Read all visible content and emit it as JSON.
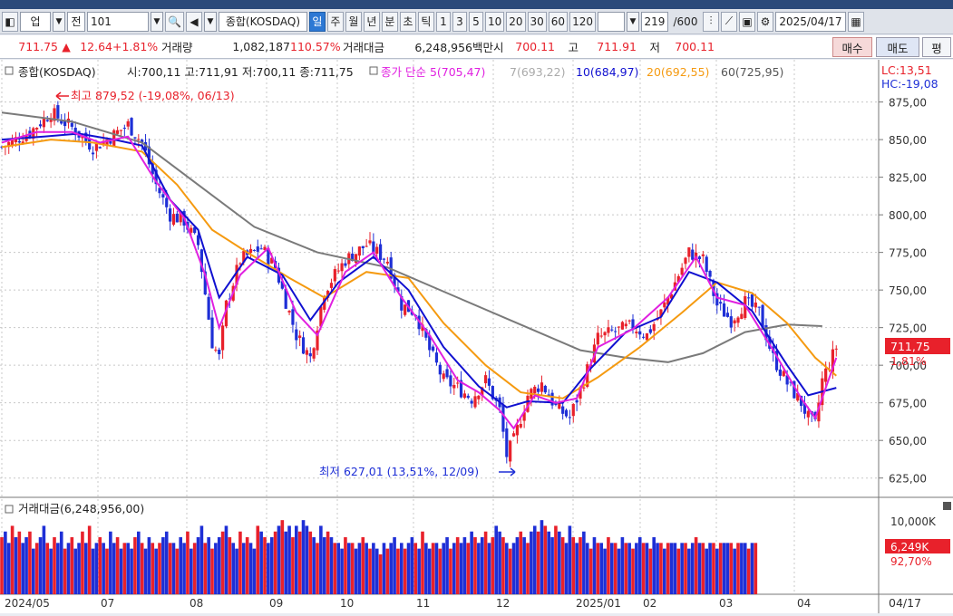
{
  "toolbar": {
    "market": "업",
    "period_type": "전",
    "code": "101",
    "index_name": "종합(KOSDAQ)",
    "periods": [
      "일",
      "주",
      "월",
      "년",
      "분",
      "초",
      "틱"
    ],
    "active_period": "일",
    "intervals": [
      "1",
      "3",
      "5",
      "10",
      "20",
      "30",
      "60",
      "120"
    ],
    "count": "219",
    "count_total": "/600",
    "date": "2025/04/17"
  },
  "quote": {
    "price": "711.75",
    "arrow": "▲",
    "change": "12.64",
    "change_pct": "+1.81%",
    "volume_label": "거래량",
    "volume": "1,082,187",
    "volume_ratio": "110.57%",
    "amount_label": "거래대금",
    "amount": "6,248,956백만",
    "open_label": "시",
    "open": "700.11",
    "high_label": "고",
    "high": "711.91",
    "low_label": "저",
    "low": "700.11",
    "buy_label": "매수",
    "sell_label": "매도",
    "avg_label": "평"
  },
  "chart": {
    "header_name": "종합(KOSDAQ)",
    "header_ohlc": "시:700,11 고:711,91 저:700,11 종:711,75",
    "ma_label": "종가 단순 5(705,47)",
    "ma7": "7(693,22)",
    "ma10": "10(684,97)",
    "ma20": "20(692,55)",
    "ma60": "60(725,95)",
    "lc": "LC:13,51",
    "hc": "HC:-19,08",
    "max_note": "최고 879,52 (-19,08%, 06/13)",
    "min_note": "최저 627,01 (13,51%, 12/09)",
    "price_tag": "711,75",
    "pct_tag": "1,81%",
    "y_ticks": [
      "875,00",
      "850,00",
      "825,00",
      "800,00",
      "775,00",
      "750,00",
      "725,00",
      "700,00",
      "675,00",
      "650,00",
      "625,00"
    ],
    "vol_header": "거래대금(6,248,956,00)",
    "vol_ticks": [
      "10,000K"
    ],
    "vol_tag": "6,249K",
    "vol_pct": "92,70%",
    "x_labels": [
      "2024/05",
      "07",
      "08",
      "09",
      "10",
      "11",
      "12",
      "2025/01",
      "02",
      "03",
      "04"
    ],
    "x_right": "04/17"
  },
  "colors": {
    "up": "#e8212b",
    "down": "#1e2fd6",
    "ma5": "#e020e0",
    "ma10": "#1010d0",
    "ma20": "#f59a10",
    "ma60": "#7a7a7a"
  },
  "chart_data": {
    "type": "line",
    "title": "",
    "ylim": [
      620,
      885
    ],
    "price_path": [
      [
        0,
        845
      ],
      [
        8,
        855
      ],
      [
        14,
        868
      ],
      [
        20,
        858
      ],
      [
        26,
        845
      ],
      [
        30,
        850
      ],
      [
        36,
        860
      ],
      [
        40,
        848
      ],
      [
        44,
        820
      ],
      [
        48,
        800
      ],
      [
        52,
        796
      ],
      [
        56,
        780
      ],
      [
        60,
        715
      ],
      [
        62,
        705
      ],
      [
        64,
        740
      ],
      [
        68,
        770
      ],
      [
        74,
        778
      ],
      [
        78,
        765
      ],
      [
        84,
        720
      ],
      [
        88,
        705
      ],
      [
        92,
        750
      ],
      [
        98,
        770
      ],
      [
        104,
        780
      ],
      [
        110,
        770
      ],
      [
        114,
        740
      ],
      [
        118,
        735
      ],
      [
        122,
        710
      ],
      [
        126,
        690
      ],
      [
        130,
        685
      ],
      [
        134,
        678
      ],
      [
        138,
        690
      ],
      [
        142,
        670
      ],
      [
        144,
        640
      ],
      [
        146,
        650
      ],
      [
        150,
        680
      ],
      [
        154,
        688
      ],
      [
        158,
        672
      ],
      [
        162,
        665
      ],
      [
        166,
        690
      ],
      [
        170,
        718
      ],
      [
        174,
        722
      ],
      [
        180,
        726
      ],
      [
        184,
        720
      ],
      [
        188,
        735
      ],
      [
        192,
        755
      ],
      [
        196,
        775
      ],
      [
        200,
        770
      ],
      [
        204,
        740
      ],
      [
        208,
        730
      ],
      [
        212,
        742
      ],
      [
        216,
        735
      ],
      [
        220,
        705
      ],
      [
        224,
        688
      ],
      [
        228,
        675
      ],
      [
        230,
        665
      ],
      [
        232,
        660
      ],
      [
        234,
        690
      ],
      [
        238,
        712
      ]
    ],
    "ma5_path": [
      [
        0,
        848
      ],
      [
        10,
        855
      ],
      [
        20,
        855
      ],
      [
        28,
        848
      ],
      [
        36,
        852
      ],
      [
        44,
        822
      ],
      [
        52,
        798
      ],
      [
        58,
        760
      ],
      [
        62,
        725
      ],
      [
        68,
        760
      ],
      [
        76,
        778
      ],
      [
        84,
        735
      ],
      [
        90,
        720
      ],
      [
        98,
        762
      ],
      [
        106,
        775
      ],
      [
        114,
        745
      ],
      [
        122,
        720
      ],
      [
        130,
        690
      ],
      [
        136,
        682
      ],
      [
        142,
        670
      ],
      [
        146,
        658
      ],
      [
        152,
        680
      ],
      [
        158,
        675
      ],
      [
        164,
        678
      ],
      [
        170,
        712
      ],
      [
        180,
        724
      ],
      [
        190,
        745
      ],
      [
        198,
        772
      ],
      [
        204,
        745
      ],
      [
        212,
        740
      ],
      [
        220,
        710
      ],
      [
        228,
        678
      ],
      [
        232,
        665
      ],
      [
        238,
        705
      ]
    ],
    "ma10_path": [
      [
        0,
        850
      ],
      [
        12,
        852
      ],
      [
        22,
        854
      ],
      [
        32,
        850
      ],
      [
        40,
        846
      ],
      [
        48,
        810
      ],
      [
        56,
        790
      ],
      [
        62,
        745
      ],
      [
        70,
        772
      ],
      [
        80,
        760
      ],
      [
        88,
        730
      ],
      [
        96,
        755
      ],
      [
        106,
        772
      ],
      [
        116,
        750
      ],
      [
        126,
        712
      ],
      [
        136,
        686
      ],
      [
        144,
        672
      ],
      [
        150,
        676
      ],
      [
        160,
        675
      ],
      [
        168,
        698
      ],
      [
        178,
        722
      ],
      [
        188,
        732
      ],
      [
        196,
        762
      ],
      [
        204,
        755
      ],
      [
        214,
        736
      ],
      [
        224,
        700
      ],
      [
        230,
        680
      ],
      [
        238,
        685
      ]
    ],
    "ma20_path": [
      [
        0,
        845
      ],
      [
        14,
        850
      ],
      [
        26,
        848
      ],
      [
        40,
        842
      ],
      [
        50,
        820
      ],
      [
        60,
        790
      ],
      [
        70,
        775
      ],
      [
        82,
        758
      ],
      [
        92,
        745
      ],
      [
        104,
        762
      ],
      [
        116,
        758
      ],
      [
        126,
        728
      ],
      [
        138,
        700
      ],
      [
        148,
        682
      ],
      [
        160,
        678
      ],
      [
        170,
        692
      ],
      [
        182,
        712
      ],
      [
        194,
        735
      ],
      [
        204,
        755
      ],
      [
        214,
        748
      ],
      [
        224,
        728
      ],
      [
        232,
        705
      ],
      [
        238,
        693
      ]
    ],
    "ma60_path": [
      [
        0,
        868
      ],
      [
        20,
        862
      ],
      [
        40,
        848
      ],
      [
        56,
        820
      ],
      [
        72,
        792
      ],
      [
        90,
        775
      ],
      [
        110,
        765
      ],
      [
        130,
        745
      ],
      [
        150,
        725
      ],
      [
        165,
        710
      ],
      [
        178,
        705
      ],
      [
        190,
        702
      ],
      [
        200,
        708
      ],
      [
        212,
        722
      ],
      [
        224,
        727
      ],
      [
        234,
        726
      ]
    ],
    "volume": [
      10,
      11,
      9,
      12,
      10,
      11,
      9,
      10,
      11,
      8,
      9,
      10,
      12,
      9,
      8,
      10,
      9,
      11,
      8,
      9,
      10,
      8,
      9,
      11,
      9,
      12,
      8,
      9,
      10,
      9,
      8,
      11,
      9,
      10,
      8,
      9,
      9,
      8,
      10,
      11,
      9,
      8,
      10,
      9,
      8,
      9,
      10,
      11,
      9,
      9,
      8,
      10,
      9,
      11,
      8,
      9,
      10,
      12,
      9,
      10,
      8,
      9,
      10,
      11,
      12,
      10,
      9,
      8,
      11,
      9,
      10,
      9,
      8,
      12,
      11,
      10,
      9,
      10,
      11,
      12,
      13,
      11,
      12,
      10,
      12,
      11,
      13,
      12,
      11,
      10,
      9,
      12,
      10,
      11,
      10,
      9,
      9,
      8,
      10,
      9,
      9,
      8,
      9,
      10,
      9,
      8,
      9,
      8,
      7,
      9,
      8,
      9,
      10,
      8,
      9,
      8,
      9,
      10,
      9,
      8,
      11,
      9,
      8,
      9,
      9,
      8,
      9,
      10,
      8,
      9,
      10,
      9,
      10,
      9,
      11,
      10,
      9,
      10,
      11,
      9,
      10,
      12,
      11,
      10,
      9,
      8,
      9,
      10,
      11,
      10,
      9,
      11,
      12,
      11,
      13,
      12,
      11,
      10,
      12,
      11,
      10,
      9,
      12,
      10,
      9,
      10,
      11,
      9,
      8,
      10,
      9,
      9,
      8,
      10,
      9,
      9,
      8,
      10,
      9,
      9,
      8,
      9,
      10,
      9,
      9,
      8,
      10,
      9,
      9,
      8,
      9,
      9,
      9,
      8,
      9,
      9,
      8,
      9,
      10,
      9,
      9,
      8,
      9,
      9,
      8,
      9,
      9,
      9,
      9,
      8,
      9,
      9,
      9,
      8,
      9,
      9
    ],
    "x_labels": [
      "2024/05",
      "07",
      "08",
      "09",
      "10",
      "11",
      "12",
      "2025/01",
      "02",
      "03",
      "04"
    ]
  }
}
